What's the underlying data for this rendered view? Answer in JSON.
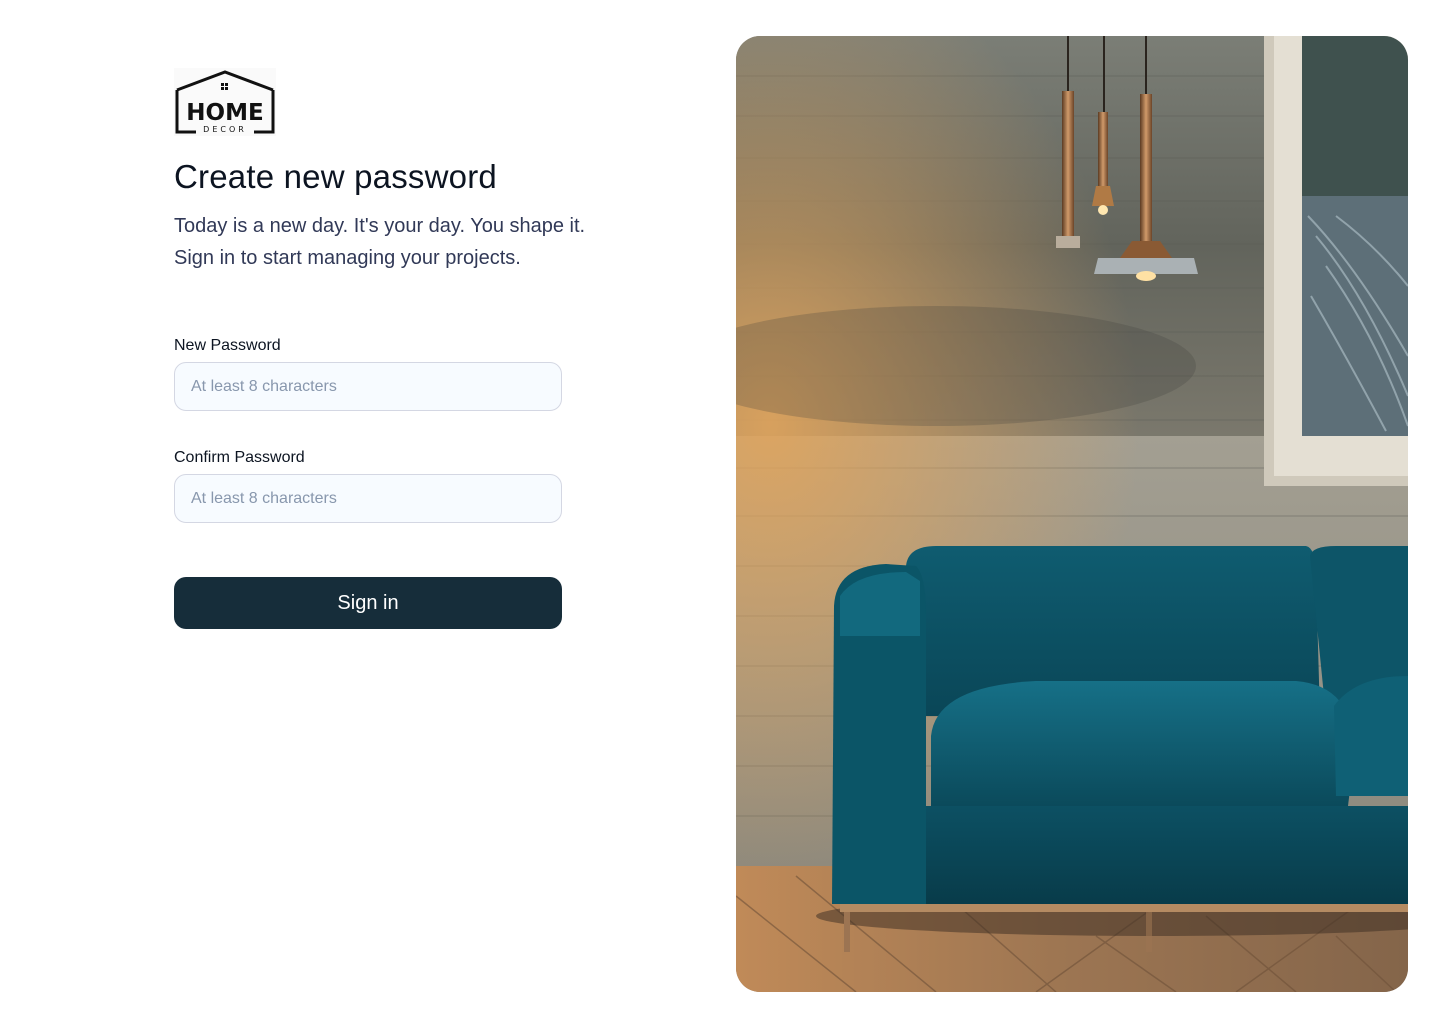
{
  "brand": {
    "logo_word": "HOME",
    "logo_sub": "DECOR"
  },
  "heading": {
    "title": "Create new password",
    "subtitle_line1": "Today is a new day. It's your day. You shape it.",
    "subtitle_line2": "Sign in to start managing your projects."
  },
  "form": {
    "new_password": {
      "label": "New Password",
      "placeholder": "At least 8 characters",
      "value": ""
    },
    "confirm_password": {
      "label": "Confirm Password",
      "placeholder": "At least 8 characters",
      "value": ""
    },
    "submit_label": "Sign in"
  },
  "hero_image": {
    "subject": "living room with teal velvet sofa and pendant lamps"
  },
  "colors": {
    "button_bg": "#162d3a",
    "input_bg": "#f7fbff",
    "input_border": "#d4d7e3",
    "sofa": "#0f5568"
  }
}
